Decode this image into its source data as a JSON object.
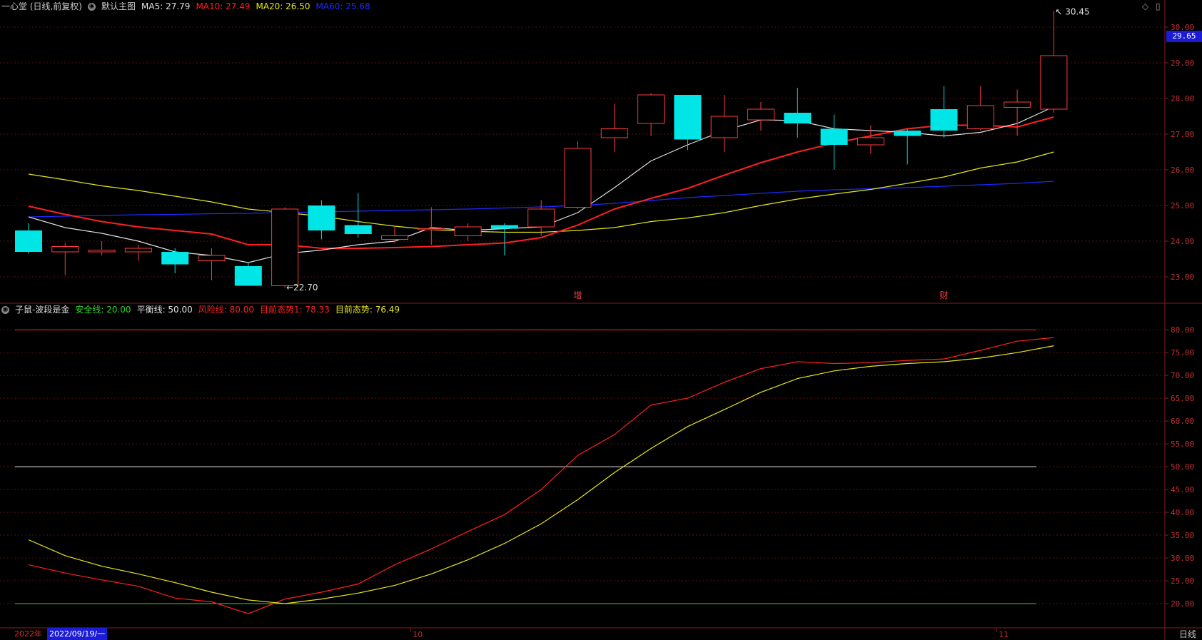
{
  "header": {
    "stock_name": "一心堂 (日线,前复权)",
    "main_chart_label": "默认主图",
    "ma_labels": [
      {
        "text": "MA5: 27.79",
        "color": "#e0e0e0"
      },
      {
        "text": "MA10: 27.49",
        "color": "#ff2020"
      },
      {
        "text": "MA20: 26.50",
        "color": "#e6e61a"
      },
      {
        "text": "MA60: 25.68",
        "color": "#1c2bff"
      }
    ]
  },
  "indicator_header": {
    "name": "子鼠-波段是金",
    "items": [
      {
        "text": "安全线: 20.00",
        "color": "#2fd62f"
      },
      {
        "text": "平衡线: 50.00",
        "color": "#e0e0e0"
      },
      {
        "text": "风险线: 80.00",
        "color": "#ff2020"
      },
      {
        "text": "目前态势1: 78.33",
        "color": "#ff2020"
      },
      {
        "text": "目前态势: 76.49",
        "color": "#e6e61a"
      }
    ]
  },
  "current_price_tag": "29.65",
  "bottom": {
    "year": "2022年",
    "cursor_date": "2022/09/19/一",
    "period": "日线"
  },
  "chart_data": [
    {
      "type": "candlestick",
      "ylim": [
        22.3,
        30.4
      ],
      "y_ticks": [
        "23.00",
        "24.00",
        "25.00",
        "26.00",
        "27.00",
        "28.00",
        "29.00",
        "30.00"
      ],
      "x_ticks": [
        "10",
        "11"
      ],
      "annotations": [
        {
          "text": "30.45",
          "bar": 28,
          "value": 30.45,
          "side": "right"
        },
        {
          "text": "←22.70",
          "bar": 7,
          "value": 22.7,
          "side": "right"
        }
      ],
      "event_markers": [
        {
          "text": "增",
          "bar": 15
        },
        {
          "text": "财",
          "bar": 25
        }
      ],
      "candles": [
        {
          "o": 24.3,
          "h": 24.5,
          "l": 23.65,
          "c": 23.7
        },
        {
          "o": 23.7,
          "h": 23.95,
          "l": 23.05,
          "c": 23.85
        },
        {
          "o": 23.7,
          "h": 24.0,
          "l": 23.6,
          "c": 23.75
        },
        {
          "o": 23.7,
          "h": 23.9,
          "l": 23.45,
          "c": 23.8
        },
        {
          "o": 23.7,
          "h": 23.8,
          "l": 23.1,
          "c": 23.35
        },
        {
          "o": 23.45,
          "h": 23.8,
          "l": 22.9,
          "c": 23.6
        },
        {
          "o": 23.3,
          "h": 23.4,
          "l": 22.75,
          "c": 22.75
        },
        {
          "o": 22.75,
          "h": 24.95,
          "l": 22.7,
          "c": 24.9
        },
        {
          "o": 25.0,
          "h": 25.15,
          "l": 24.05,
          "c": 24.3
        },
        {
          "o": 24.45,
          "h": 25.35,
          "l": 24.1,
          "c": 24.2
        },
        {
          "o": 24.05,
          "h": 24.4,
          "l": 23.95,
          "c": 24.15
        },
        {
          "o": 24.35,
          "h": 24.95,
          "l": 23.9,
          "c": 24.35
        },
        {
          "o": 24.15,
          "h": 24.5,
          "l": 24.0,
          "c": 24.4
        },
        {
          "o": 24.45,
          "h": 24.5,
          "l": 23.6,
          "c": 24.35
        },
        {
          "o": 24.4,
          "h": 25.15,
          "l": 24.15,
          "c": 24.9
        },
        {
          "o": 24.95,
          "h": 26.8,
          "l": 24.9,
          "c": 26.6
        },
        {
          "o": 26.9,
          "h": 27.85,
          "l": 26.5,
          "c": 27.15
        },
        {
          "o": 27.3,
          "h": 28.15,
          "l": 26.95,
          "c": 28.1
        },
        {
          "o": 28.1,
          "h": 28.1,
          "l": 26.55,
          "c": 26.85
        },
        {
          "o": 26.9,
          "h": 28.1,
          "l": 26.5,
          "c": 27.5
        },
        {
          "o": 27.4,
          "h": 27.9,
          "l": 27.1,
          "c": 27.7
        },
        {
          "o": 27.6,
          "h": 28.3,
          "l": 26.9,
          "c": 27.3
        },
        {
          "o": 27.15,
          "h": 27.55,
          "l": 26.0,
          "c": 26.7
        },
        {
          "o": 26.7,
          "h": 27.25,
          "l": 26.45,
          "c": 26.9
        },
        {
          "o": 27.1,
          "h": 27.15,
          "l": 26.15,
          "c": 26.95
        },
        {
          "o": 27.7,
          "h": 28.35,
          "l": 26.9,
          "c": 27.1
        },
        {
          "o": 27.15,
          "h": 28.35,
          "l": 27.1,
          "c": 27.8
        },
        {
          "o": 27.75,
          "h": 28.25,
          "l": 26.95,
          "c": 27.9
        },
        {
          "o": 27.7,
          "h": 30.45,
          "l": 27.6,
          "c": 29.2
        }
      ],
      "series": [
        {
          "name": "MA5",
          "color": "#e0e0e0",
          "width": 1.2,
          "values": [
            24.68,
            24.38,
            24.22,
            24.0,
            23.7,
            23.6,
            23.4,
            23.65,
            23.75,
            23.9,
            24.0,
            24.38,
            24.3,
            24.35,
            24.4,
            24.8,
            25.5,
            26.25,
            26.7,
            27.1,
            27.4,
            27.38,
            27.15,
            27.1,
            27.05,
            26.95,
            27.05,
            27.3,
            27.77
          ]
        },
        {
          "name": "MA10",
          "color": "#ff2020",
          "width": 2,
          "values": [
            24.98,
            24.75,
            24.55,
            24.4,
            24.3,
            24.2,
            23.9,
            23.9,
            23.8,
            23.8,
            23.82,
            23.85,
            23.9,
            23.95,
            24.1,
            24.45,
            24.9,
            25.2,
            25.48,
            25.85,
            26.2,
            26.5,
            26.75,
            26.95,
            27.15,
            27.25,
            27.25,
            27.2,
            27.48
          ]
        },
        {
          "name": "MA20",
          "color": "#e6e61a",
          "width": 1.2,
          "values": [
            25.88,
            25.72,
            25.55,
            25.42,
            25.26,
            25.1,
            24.9,
            24.8,
            24.7,
            24.55,
            24.42,
            24.32,
            24.28,
            24.25,
            24.25,
            24.3,
            24.38,
            24.55,
            24.65,
            24.8,
            25.0,
            25.18,
            25.32,
            25.45,
            25.62,
            25.8,
            26.05,
            26.22,
            26.5
          ]
        },
        {
          "name": "MA60",
          "color": "#1c2bff",
          "width": 1.2,
          "values": [
            24.68,
            24.7,
            24.72,
            24.74,
            24.75,
            24.77,
            24.78,
            24.8,
            24.82,
            24.84,
            24.86,
            24.88,
            24.9,
            24.93,
            24.96,
            25.0,
            25.06,
            25.14,
            25.22,
            25.28,
            25.34,
            25.4,
            25.44,
            25.47,
            25.5,
            25.54,
            25.58,
            25.62,
            25.68
          ]
        }
      ]
    },
    {
      "type": "line",
      "ylim": [
        15,
        83
      ],
      "y_ticks": [
        "20.00",
        "25.00",
        "30.00",
        "35.00",
        "40.00",
        "45.00",
        "50.00",
        "55.00",
        "60.00",
        "65.00",
        "70.00",
        "75.00",
        "80.00"
      ],
      "reference_lines": [
        {
          "value": 80,
          "color": "#ff2020"
        },
        {
          "value": 50,
          "color": "#e0e0e0"
        },
        {
          "value": 20,
          "color": "#2fd62f"
        }
      ],
      "series": [
        {
          "name": "目前态势1",
          "color": "#ff2020",
          "values": [
            28.5,
            26.7,
            25.2,
            23.8,
            21.2,
            20.4,
            17.8,
            21.0,
            22.5,
            24.3,
            28.5,
            32.0,
            35.8,
            39.5,
            45.0,
            52.5,
            57.0,
            63.5,
            65.0,
            68.5,
            71.5,
            73.0,
            72.6,
            72.8,
            73.3,
            73.6,
            75.5,
            77.5,
            78.3
          ]
        },
        {
          "name": "目前态势",
          "color": "#e6e61a",
          "values": [
            34.0,
            30.5,
            28.2,
            26.5,
            24.6,
            22.5,
            20.8,
            20.0,
            21.0,
            22.3,
            24.0,
            26.5,
            29.6,
            33.2,
            37.5,
            42.8,
            48.7,
            54.0,
            58.8,
            62.5,
            66.3,
            69.3,
            71.0,
            72.0,
            72.6,
            73.0,
            73.8,
            75.0,
            76.5
          ]
        }
      ]
    }
  ]
}
